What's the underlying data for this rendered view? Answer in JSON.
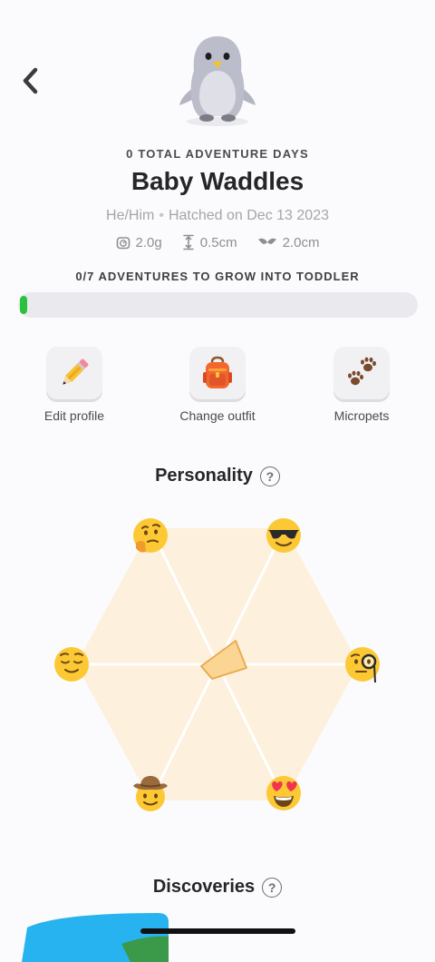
{
  "header": {
    "back_icon": "chevron-left-icon"
  },
  "pet": {
    "total_days_label": "0 TOTAL ADVENTURE DAYS",
    "name": "Baby Waddles",
    "pronouns": "He/Him",
    "hatched": "Hatched on Dec 13 2023",
    "stats": [
      {
        "icon": "weight-scale-icon",
        "value": "2.0g"
      },
      {
        "icon": "height-icon",
        "value": "0.5cm"
      },
      {
        "icon": "wingspan-icon",
        "value": "2.0cm"
      }
    ]
  },
  "growth": {
    "label": "0/7 ADVENTURES TO GROW INTO TODDLER",
    "progress": 0,
    "fill_color": "#2ac23d"
  },
  "actions": [
    {
      "label": "Edit profile",
      "icon": "pencil-icon"
    },
    {
      "label": "Change outfit",
      "icon": "backpack-icon"
    },
    {
      "label": "Micropets",
      "icon": "paw-prints-icon"
    }
  ],
  "personality": {
    "title": "Personality",
    "help": "?",
    "traits": [
      {
        "icon": "thinking-face-icon"
      },
      {
        "icon": "sunglasses-face-icon"
      },
      {
        "icon": "monocle-face-icon"
      },
      {
        "icon": "heart-eyes-face-icon"
      },
      {
        "icon": "cowboy-face-icon"
      },
      {
        "icon": "relieved-face-icon"
      }
    ],
    "colors": {
      "hexagon": "#fdf0dc",
      "shape": "#fbd593"
    }
  },
  "discoveries": {
    "title": "Discoveries",
    "help": "?"
  }
}
